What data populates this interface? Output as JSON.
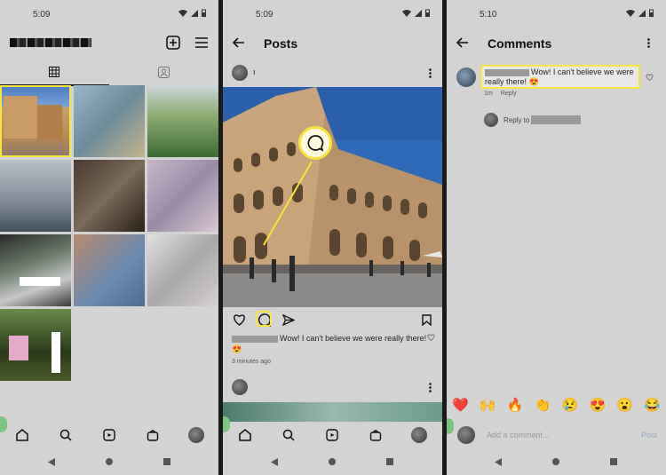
{
  "screen1": {
    "status_time": "5:09",
    "username": "",
    "tabs": [
      "grid-icon",
      "tagged-icon"
    ]
  },
  "screen2": {
    "status_time": "5:09",
    "title": "Posts",
    "post_username": "ı",
    "caption": "Wow! I can't believe we were really there! 😍",
    "time_ago": "3 minutes ago"
  },
  "screen3": {
    "status_time": "5:10",
    "title": "Comments",
    "comment_text": "Wow! I can't believe we were really there! 😍",
    "comment_age": "1m",
    "reply_label": "Reply",
    "reply_to_label": "Reply to",
    "emojis": [
      "❤️",
      "🙌",
      "🔥",
      "👏",
      "😢",
      "😍",
      "😮",
      "😂"
    ],
    "add_comment_placeholder": "Add a comment...",
    "post_label": "Post"
  },
  "colors": {
    "highlight": "#f5e53c",
    "background": "#d3d3d3"
  }
}
